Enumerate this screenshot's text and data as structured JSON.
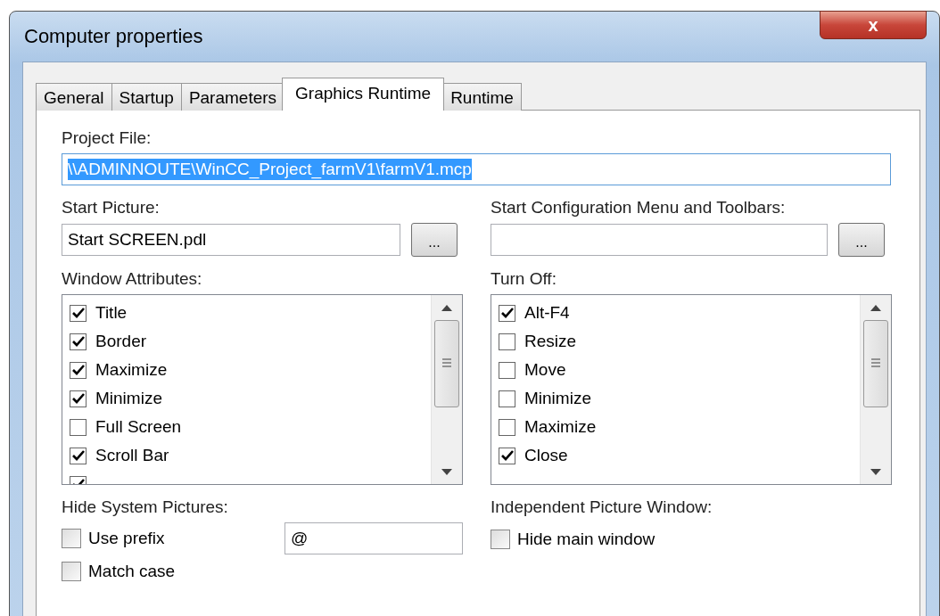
{
  "window": {
    "title": "Computer properties",
    "close": "x"
  },
  "tabs": [
    {
      "label": "General",
      "selected": false
    },
    {
      "label": "Startup",
      "selected": false
    },
    {
      "label": "Parameters",
      "selected": false
    },
    {
      "label": "Graphics Runtime",
      "selected": true
    },
    {
      "label": "Runtime",
      "selected": false
    }
  ],
  "project_file": {
    "label": "Project File:",
    "value": "\\\\ADMINNOUTE\\WinCC_Project_farmV1\\farmV1.mcp"
  },
  "start_picture": {
    "label": "Start Picture:",
    "value": "Start SCREEN.pdl",
    "button": "..."
  },
  "start_config": {
    "label": "Start Configuration Menu and Toolbars:",
    "button": "..."
  },
  "window_attributes": {
    "label": "Window Attributes:",
    "items": [
      {
        "label": "Title",
        "checked": true
      },
      {
        "label": "Border",
        "checked": true
      },
      {
        "label": "Maximize",
        "checked": true
      },
      {
        "label": "Minimize",
        "checked": true
      },
      {
        "label": "Full Screen",
        "checked": false
      },
      {
        "label": "Scroll Bar",
        "checked": true
      },
      {
        "checked": true
      }
    ]
  },
  "turn_off": {
    "label": "Turn Off:",
    "items": [
      {
        "label": "Alt-F4",
        "checked": true
      },
      {
        "label": "Resize",
        "checked": false
      },
      {
        "label": "Move",
        "checked": false
      },
      {
        "label": "Minimize",
        "checked": false
      },
      {
        "label": "Maximize",
        "checked": false
      },
      {
        "label": "Close",
        "checked": true
      }
    ]
  },
  "hide_system_pictures": {
    "label": "Hide System Pictures:",
    "use_prefix": {
      "label": "Use prefix",
      "checked": false
    },
    "prefix": "@",
    "match_case": {
      "label": "Match case",
      "checked": false
    }
  },
  "independent_picture_window": {
    "label": "Independent Picture Window:",
    "hide_main_window": {
      "label": "Hide main window",
      "checked": false
    }
  }
}
